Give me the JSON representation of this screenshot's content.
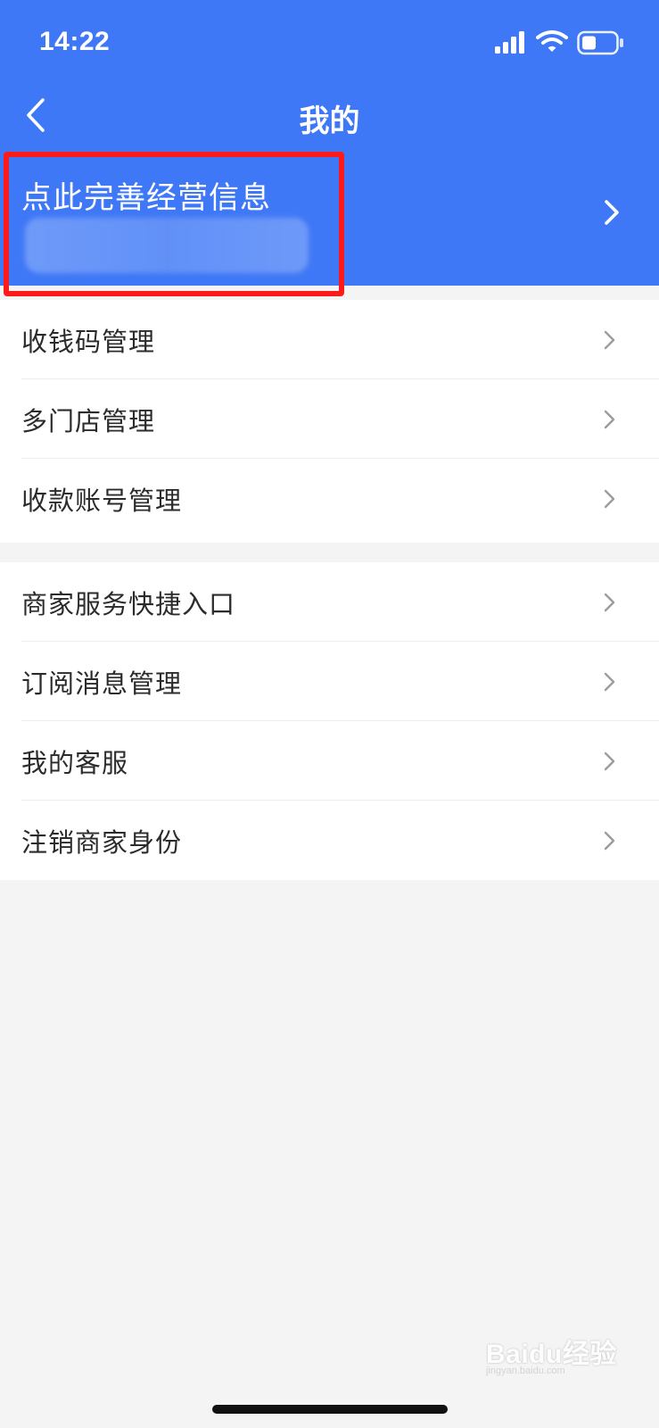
{
  "status_bar": {
    "time": "14:22",
    "icons": [
      "signal-icon",
      "wifi-icon",
      "battery-icon"
    ]
  },
  "nav": {
    "title": "我的",
    "back_icon": "back-chevron-icon"
  },
  "profile": {
    "title": "点此完善经营信息",
    "chevron_icon": "chevron-right-icon"
  },
  "menu_group_1": [
    {
      "label": "收钱码管理"
    },
    {
      "label": "多门店管理"
    },
    {
      "label": "收款账号管理"
    }
  ],
  "menu_group_2": [
    {
      "label": "商家服务快捷入口"
    },
    {
      "label": "订阅消息管理"
    },
    {
      "label": "我的客服"
    },
    {
      "label": "注销商家身份"
    }
  ],
  "watermark": {
    "brand": "Baidu经验",
    "url": "jingyan.baidu.com"
  },
  "colors": {
    "header_blue": "#3f78f6",
    "highlight_red": "#ff1a1a",
    "background": "#f4f4f4"
  }
}
